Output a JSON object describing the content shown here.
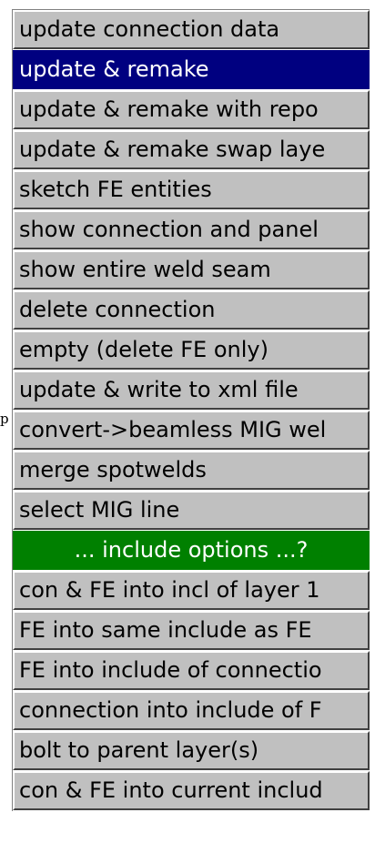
{
  "stray_text": "p",
  "colors": {
    "button_face": "#c0c0c0",
    "selected_bg": "#000080",
    "header_bg": "#008000"
  },
  "menu": {
    "items": [
      {
        "label": "update connection data",
        "state": "normal"
      },
      {
        "label": "update & remake",
        "state": "selected"
      },
      {
        "label": "update & remake with repo",
        "state": "normal"
      },
      {
        "label": "update & remake swap laye",
        "state": "normal"
      },
      {
        "label": "sketch FE entities",
        "state": "normal"
      },
      {
        "label": "show connection and panel",
        "state": "normal"
      },
      {
        "label": "show entire weld seam",
        "state": "normal"
      },
      {
        "label": "delete connection",
        "state": "normal"
      },
      {
        "label": "empty (delete FE only)",
        "state": "normal"
      },
      {
        "label": "update & write to xml file",
        "state": "normal"
      },
      {
        "label": "convert->beamless MIG wel",
        "state": "normal"
      },
      {
        "label": "merge spotwelds",
        "state": "normal"
      },
      {
        "label": "select MIG line",
        "state": "normal"
      },
      {
        "label": "... include options ...?",
        "state": "header"
      },
      {
        "label": "con & FE into incl of layer 1",
        "state": "normal"
      },
      {
        "label": "FE into same include as FE",
        "state": "normal"
      },
      {
        "label": "FE into include of connectio",
        "state": "normal"
      },
      {
        "label": "connection into include of F",
        "state": "normal"
      },
      {
        "label": "bolt to parent layer(s)",
        "state": "normal"
      },
      {
        "label": "con & FE into current includ",
        "state": "normal"
      }
    ]
  }
}
